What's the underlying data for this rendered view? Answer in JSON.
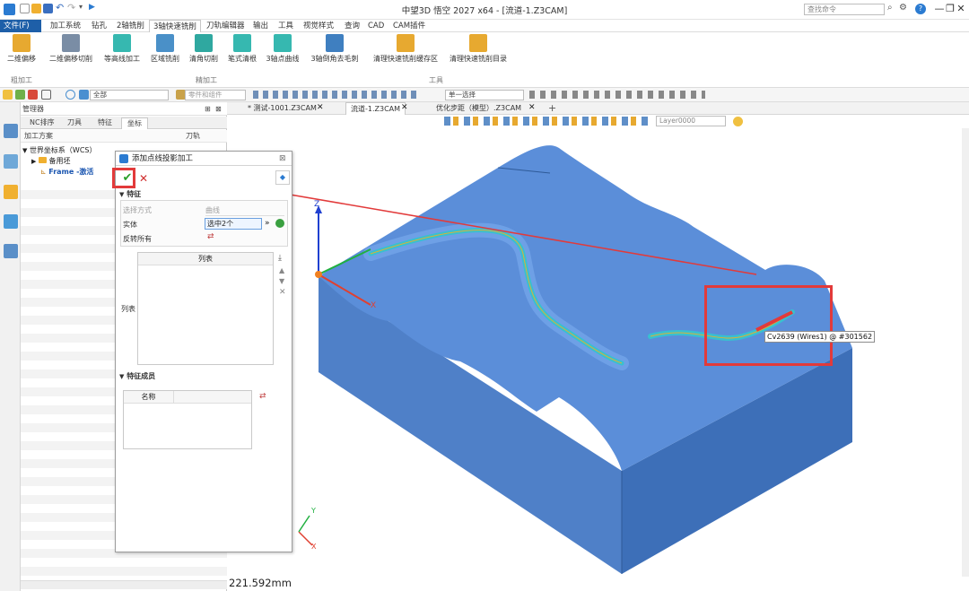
{
  "window": {
    "title": "中望3D 悟空 2027 x64 - [流道-1.Z3CAM]",
    "search_placeholder": "查找命令",
    "controls": [
      "—",
      "❐",
      "✕"
    ]
  },
  "menu": {
    "items": [
      "文件(F)",
      "加工系统",
      "钻孔",
      "2轴铣削",
      "3轴快速铣削",
      "刀轨编辑器",
      "输出",
      "工具",
      "视觉样式",
      "查询",
      "CAD",
      "CAM插件"
    ],
    "active_index": 4
  },
  "ribbon": {
    "buttons": [
      "二维偏移",
      "二维偏移切削",
      "等高线加工",
      "区域铣削",
      "清角切削",
      "笔式清根",
      "3轴点曲线",
      "3轴倒角去毛刺",
      "清理快速铣削缓存区",
      "清理快速铣削目录"
    ],
    "groups": [
      "粗加工",
      "精加工",
      "工具"
    ]
  },
  "toolbar": {
    "filter_value": "全部",
    "part_value": "零件和组件",
    "select_mode": "单一选择",
    "layer": "Layer0000"
  },
  "manager": {
    "title": "管理器",
    "tabs": [
      "NC排序",
      "刀具",
      "特征",
      "坐标"
    ],
    "active_tab": 3,
    "columns": [
      "加工方案",
      "刀轨"
    ],
    "tree": {
      "root": "世界坐标系（WCS）",
      "child1": "备用坯",
      "child2": "Frame -激活"
    }
  },
  "document_tabs": [
    "* 测试-1001.Z3CAM",
    "流道-1.Z3CAM",
    "优化步距（模型）.Z3CAM"
  ],
  "active_document": 1,
  "dialog": {
    "title": "添加点线投影加工",
    "section_feature": "特征",
    "select_mode_label": "选择方式",
    "select_mode_value": "曲线",
    "entity_label": "实体",
    "entity_value": "选中2个",
    "reverse_label": "反转所有",
    "list_header": "列表",
    "list_label": "列表",
    "section_members": "特征成员",
    "members_col": "名称"
  },
  "viewport": {
    "tooltip": "Cv2639 (Wires1) @ #301562",
    "distance": "221.592mm",
    "axis_x": "X",
    "axis_y": "Y",
    "axis_z": "Z"
  },
  "colors": {
    "part_top": "#5b8ed9",
    "part_front": "#3d6fb8",
    "part_side": "#4f80c8",
    "toolpath": "#38c0d0",
    "annotation": "#e23a3a",
    "menu_file": "#1e5fa8"
  }
}
